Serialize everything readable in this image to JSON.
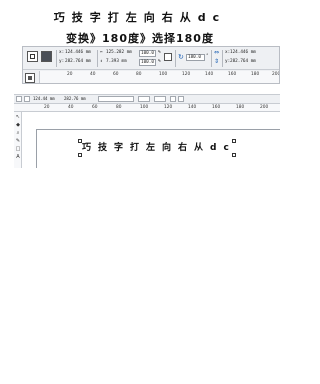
{
  "heading": {
    "title": "巧技字打左向右从dc",
    "subtitle": "变换》180度》选择180度"
  },
  "property_bar": {
    "x_value": "124.446 mm",
    "y_value": "282.764 mm",
    "width_value": "125.282 mm",
    "height_value": "7.393 mm",
    "scale_x": "100.0",
    "scale_y": "100.0",
    "percent": "%",
    "rotation": "180.0",
    "rotation_unit": "°",
    "x_value_2": "124.446 mm",
    "y_value_2": "282.764 mm",
    "ruler_ticks": [
      "20",
      "40",
      "60",
      "80",
      "100",
      "120",
      "140",
      "160",
      "180",
      "200"
    ]
  },
  "editor": {
    "x_value": "124.44 mm",
    "y_value": "282.76 mm",
    "ruler_ticks": [
      "20",
      "40",
      "60",
      "80",
      "100",
      "120",
      "140",
      "160",
      "180",
      "200"
    ],
    "canvas_text": "巧技字打左向右从dc"
  },
  "colors": {
    "toolbar_bg": "#eef0f3",
    "rotation_icon": "#1a5fb4"
  }
}
